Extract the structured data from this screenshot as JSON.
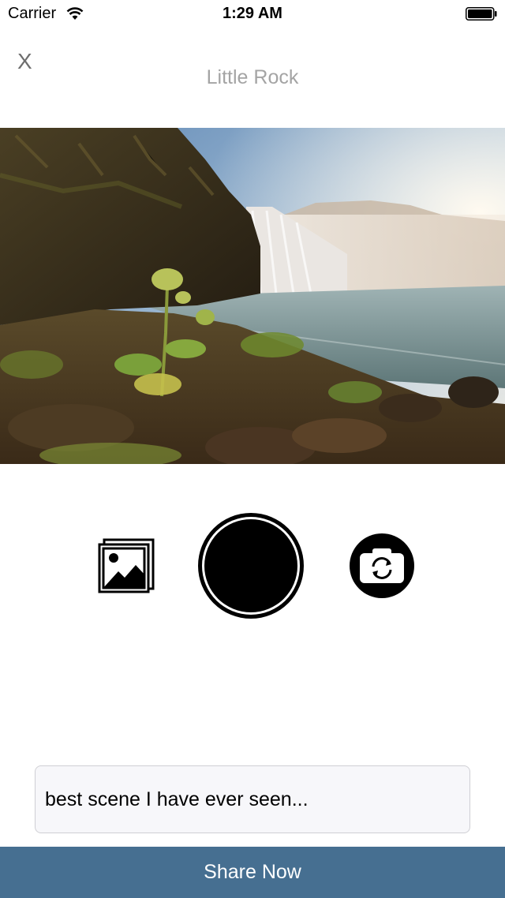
{
  "status_bar": {
    "carrier": "Carrier",
    "time": "1:29 AM",
    "wifi_icon": "wifi-icon",
    "battery_icon": "battery-icon"
  },
  "nav": {
    "close_label": "X",
    "title": "Little Rock"
  },
  "photo": {
    "subject": "waterfall-photo"
  },
  "controls": {
    "gallery_icon": "gallery-icon",
    "shutter_icon": "shutter-icon",
    "switch_camera_icon": "switch-camera-icon"
  },
  "caption": {
    "value": "best scene I have ever seen...",
    "placeholder": ""
  },
  "share": {
    "label": "Share Now",
    "color": "#466f91"
  }
}
